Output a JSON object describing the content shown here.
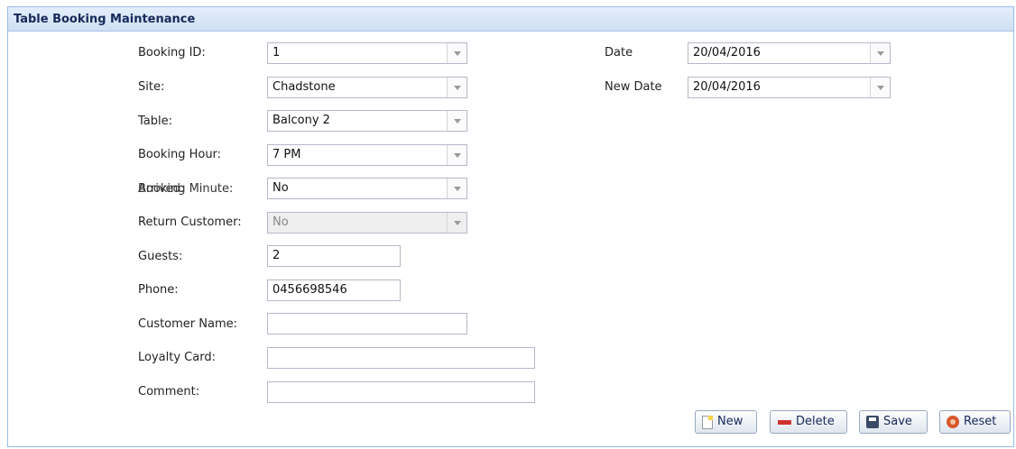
{
  "panel": {
    "title": "Table Booking Maintenance"
  },
  "form": {
    "booking_id": {
      "label": "Booking ID:",
      "value": "1"
    },
    "site": {
      "label": "Site:",
      "value": "Chadstone"
    },
    "table": {
      "label": "Table:",
      "value": "Balcony 2"
    },
    "booking_hour": {
      "label": "Booking Hour:",
      "value": "7 PM"
    },
    "booking_minute": {
      "label": "Booking Minute:"
    },
    "arrived": {
      "label": "Arrived:",
      "value": "No"
    },
    "return_customer": {
      "label": "Return Customer:",
      "value": "No"
    },
    "guests": {
      "label": "Guests:",
      "value": "2"
    },
    "phone": {
      "label": "Phone:",
      "value": "0456698546"
    },
    "customer_name": {
      "label": "Customer Name:",
      "value": ""
    },
    "loyalty_card": {
      "label": "Loyalty Card:",
      "value": ""
    },
    "comment": {
      "label": "Comment:",
      "value": ""
    },
    "date": {
      "label": "Date",
      "value": "20/04/2016"
    },
    "new_date": {
      "label": "New Date",
      "value": "20/04/2016"
    }
  },
  "toolbar": {
    "new_label": "New",
    "delete_label": "Delete",
    "save_label": "Save",
    "reset_label": "Reset"
  },
  "icons": [
    "new-icon",
    "delete-icon",
    "save-icon",
    "reset-icon",
    "dropdown-arrow-icon"
  ]
}
